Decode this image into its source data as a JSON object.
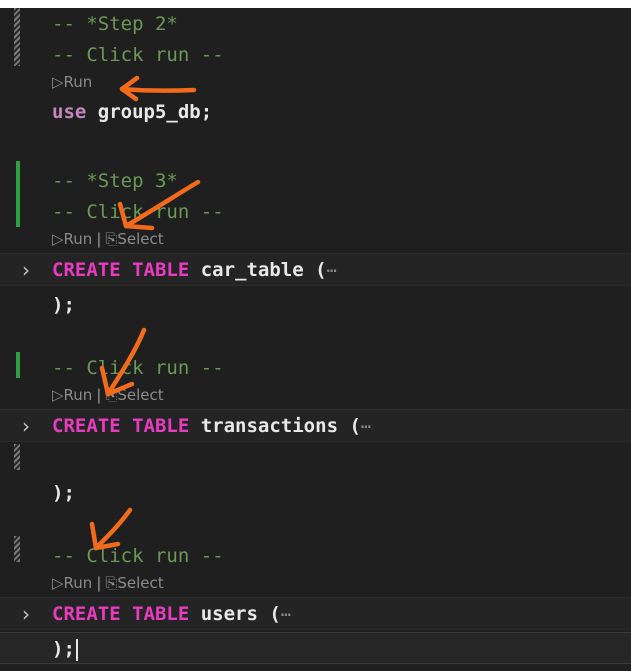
{
  "editor": {
    "lines": {
      "step2_comment": "-- *Step 2*",
      "click_run_1": "-- Click run --",
      "run_lens_1": "▷Run",
      "use_keyword": "use",
      "use_db": "group5_db;",
      "step3_comment": "-- *Step 3*",
      "click_run_2": "-- Click run --",
      "run_lens_2": "▷Run",
      "select_lens_2": "⎘Select",
      "create_kw_1": "CREATE TABLE",
      "table_1": "car_table (",
      "ellipsis_1": "⋯",
      "close_1": ");",
      "click_run_3": "-- Click run --",
      "run_lens_3": "▷Run",
      "select_lens_3": "⎘Select",
      "create_kw_2": "CREATE TABLE",
      "table_2": "transactions (",
      "ellipsis_2": "⋯",
      "close_2": ");",
      "click_run_4": "-- Click run --",
      "run_lens_4": "▷Run",
      "select_lens_4": "⎘Select",
      "create_kw_3": "CREATE TABLE",
      "table_3": "users (",
      "ellipsis_3": "⋯",
      "close_3": ");",
      "lens_separator": "|",
      "fold_chevron": "›"
    }
  },
  "colors": {
    "background": "#1f1f1f",
    "comment": "#6a9955",
    "keyword": "#e83cc0",
    "annotation_arrow": "#f26b1d",
    "gutter_added": "#2ea043"
  }
}
